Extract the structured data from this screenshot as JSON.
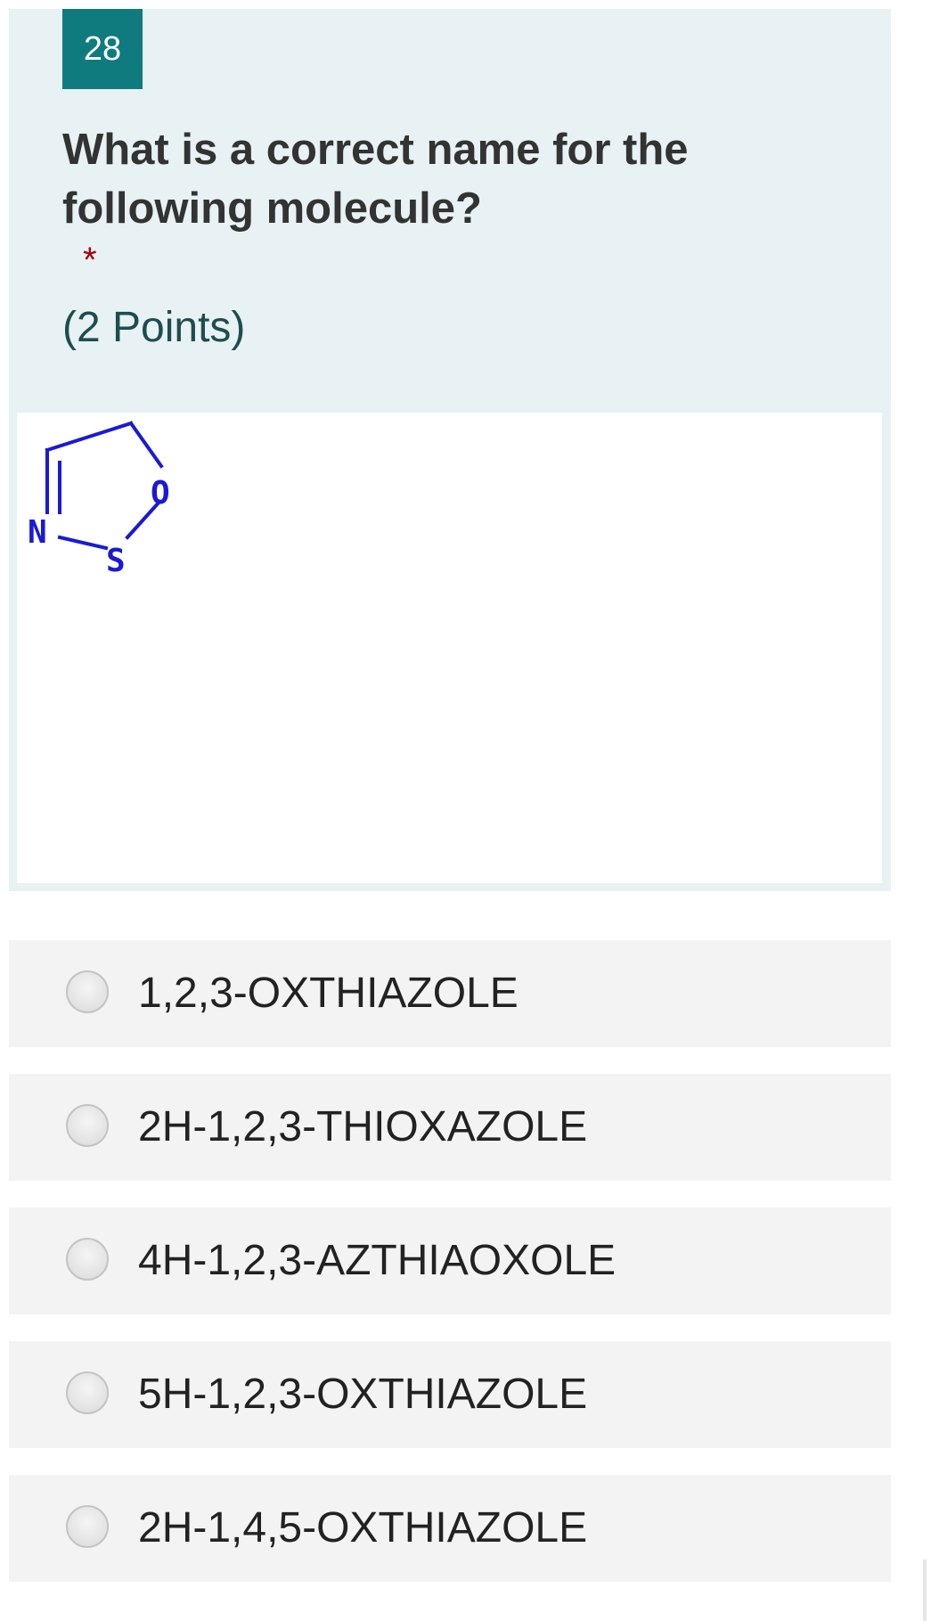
{
  "question": {
    "number": "28",
    "title": "What is a correct name for the following molecule?",
    "required_marker": "*",
    "points": "(2 Points)"
  },
  "molecule": {
    "atoms": {
      "nitrogen": "N",
      "sulfur": "S",
      "oxygen": "O"
    }
  },
  "options": [
    {
      "label": "1,2,3-OXTHIAZOLE",
      "selected": false
    },
    {
      "label": "2H-1,2,3-THIOXAZOLE",
      "selected": false
    },
    {
      "label": "4H-1,2,3-AZTHIAOXOLE",
      "selected": false
    },
    {
      "label": "5H-1,2,3-OXTHIAZOLE",
      "selected": false
    },
    {
      "label": "2H-1,4,5-OXTHIAZOLE",
      "selected": false
    }
  ],
  "colors": {
    "accent": "#0f7b7f",
    "question_background": "#e8f1f3",
    "required": "#a8000b",
    "molecule": "#1a1ad6"
  }
}
